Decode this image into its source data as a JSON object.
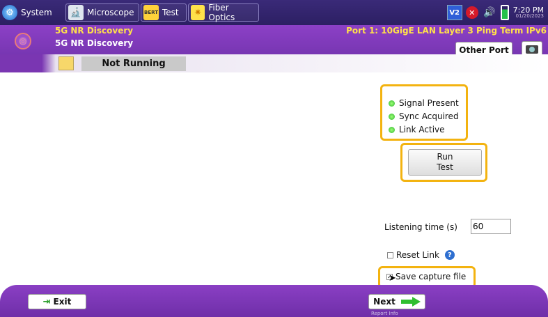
{
  "taskbar": {
    "items": [
      {
        "label": "System",
        "icon": "gear-icon"
      },
      {
        "label": "Microscope",
        "icon": "microscope-icon"
      },
      {
        "label": "Test",
        "icon": "bert-icon",
        "icon_text": "BERT"
      },
      {
        "label": "Fiber Optics",
        "icon": "fiber-star-icon"
      }
    ],
    "tray": {
      "v2_label": "V2",
      "network_icon": "network-error-icon",
      "volume_icon": "speaker-icon",
      "battery_icon": "battery-icon",
      "time": "7:20 PM",
      "date": "01/20/2023"
    }
  },
  "header": {
    "test_title": "5G NR Discovery",
    "sub_title": "5G NR Discovery",
    "port_title": "Port 1: 10GigE LAN Layer 3 Ping Term IPv6",
    "other_port_label": "Other Port",
    "camera_icon": "camera-icon"
  },
  "status": {
    "run_state": "Not Running"
  },
  "main": {
    "indicators": [
      {
        "label": "Signal Present",
        "color": "#3ddc3d"
      },
      {
        "label": "Sync Acquired",
        "color": "#3ddc3d"
      },
      {
        "label": "Link Active",
        "color": "#3ddc3d"
      }
    ],
    "run_test_line1": "Run",
    "run_test_line2": "Test",
    "listening_time_label": "Listening time (s)",
    "listening_time_value": "60",
    "reset_link_label": "Reset Link",
    "reset_link_checked": false,
    "save_capture_label": "Save capture file",
    "save_capture_checked": true
  },
  "footer": {
    "exit_label": "Exit",
    "next_label": "Next",
    "report_info": "Report Info"
  },
  "colors": {
    "accent_purple": "#8c40c6",
    "highlight_yellow": "#f3b310",
    "header_yellow_text": "#ffe04a",
    "led_green": "#3ddc3d"
  }
}
